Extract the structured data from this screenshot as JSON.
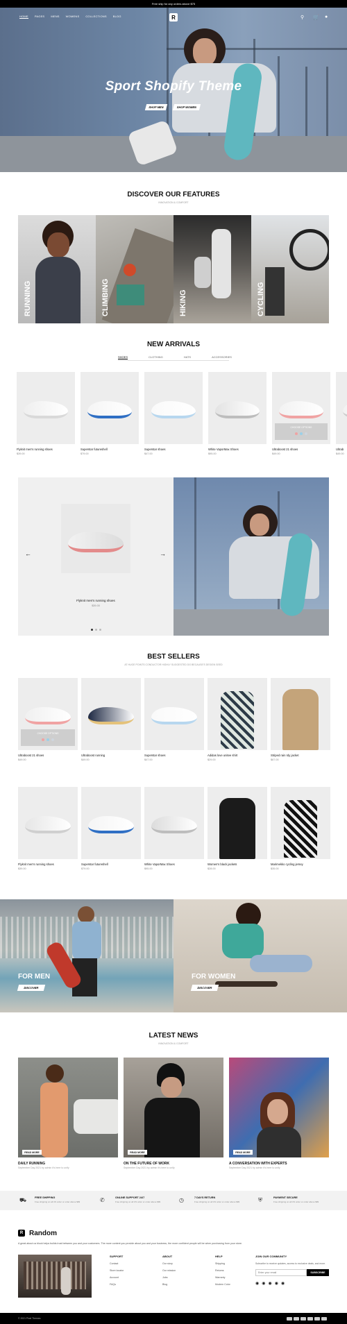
{
  "announcement": "Free ship for any orders above $75",
  "nav": {
    "items": [
      "HOME",
      "PAGES",
      "MENS",
      "WOMENS",
      "COLLECTIONS",
      "BLOG"
    ],
    "logo": "R"
  },
  "hero": {
    "title": "Sport Shopify Theme",
    "btn_men": "SHOP MEN",
    "btn_women": "SHOP WOMEN"
  },
  "features": {
    "title": "DISCOVER OUR FEATURES",
    "subtitle": "INNOVATION & COMFORT",
    "items": [
      "RUNNING",
      "CLIMBING",
      "HIKING",
      "CYCLING"
    ]
  },
  "arrivals": {
    "title": "NEW ARRIVALS",
    "tabs": [
      "SHOES",
      "CLOTHING",
      "HATS",
      "ACCESSORIES"
    ],
    "products": [
      {
        "name": "Flyknit men's running shoes",
        "price": "$39.00"
      },
      {
        "name": "Superstar futureshell",
        "price": "$79.00"
      },
      {
        "name": "Superstar shoes",
        "price": "$47.00"
      },
      {
        "name": "White VaporMax Shoes",
        "price": "$95.00"
      },
      {
        "name": "Ultraboost 21 shoes",
        "price": "$49.00"
      },
      {
        "name": "Ultrab",
        "price": "$49.00"
      }
    ],
    "hover_label": "CHOOSE OPTIONS"
  },
  "promo": {
    "name": "Flyknit men's running shoes",
    "price": "$39.00"
  },
  "bestsellers": {
    "title": "BEST SELLERS",
    "subtitle": "AT HUGE POINTS CONDUCTOR HIGHLY SUGGESTED DO BECAUSE'S DESIGN SEED",
    "row1": [
      {
        "name": "Ultraboost 21 shoes",
        "price": "$49.00"
      },
      {
        "name": "Ultraboost running",
        "price": "$49.00"
      },
      {
        "name": "Superstar shoes",
        "price": "$47.00"
      },
      {
        "name": "Adidas love unitee shirt",
        "price": "$29.00"
      },
      {
        "name": "Striped rain rdy jacket",
        "price": "$67.00"
      }
    ],
    "row2": [
      {
        "name": "Flyknit men's running shoes",
        "price": "$39.00"
      },
      {
        "name": "Superstar futureshell",
        "price": "$79.00"
      },
      {
        "name": "White VaporMax Shoes",
        "price": "$95.00"
      },
      {
        "name": "Women's black jackets",
        "price": "$28.00"
      },
      {
        "name": "Marimekko cycling jersey",
        "price": "$35.00"
      }
    ],
    "hover_label": "CHOOSE OPTIONS"
  },
  "banners": [
    {
      "title": "FOR MEN",
      "button": "DISCOVER"
    },
    {
      "title": "FOR WOMEN",
      "button": "DISCOVER"
    }
  ],
  "news": {
    "title": "LATEST NEWS",
    "subtitle": "INNOVATION & COMFORT",
    "items": [
      {
        "title": "DAILY RUNNING",
        "date": "September Day 2021 by admin it's here to unify",
        "button": "READ MORE"
      },
      {
        "title": "ON THE FUTURE OF WORK",
        "date": "September Day 2021 by admin it's here to unify",
        "button": "READ MORE"
      },
      {
        "title": "A CONVERSATION WITH EXPERTS",
        "date": "September Day 2021 by admin it's here to unify",
        "button": "READ MORE"
      }
    ]
  },
  "service": [
    {
      "title": "FREE SHIPPING",
      "desc": "Free shipping on all US order or order above $99",
      "icon": "truck-icon"
    },
    {
      "title": "ONLINE SUPPORT 24/7",
      "desc": "Free shipping on all US order or order above $99",
      "icon": "phone-icon"
    },
    {
      "title": "7 DAYS RETURN",
      "desc": "Free shipping on all US order or order above $99",
      "icon": "clock-icon"
    },
    {
      "title": "PAYMENT SECURE",
      "desc": "Free shipping on all US order or order above $99",
      "icon": "shield-icon"
    }
  ],
  "footer": {
    "brand": "Random",
    "about": "A great about us block helps builds trust between you and your customers. The more content you provide about you and your business, the more confident people will be when purchasing from your store.",
    "columns": [
      {
        "title": "SUPPORT",
        "links": [
          "Contact",
          "Store locator",
          "Account",
          "FAQs"
        ]
      },
      {
        "title": "ABOUT",
        "links": [
          "Our story",
          "Our mission",
          "Jobs",
          "Blog"
        ]
      },
      {
        "title": "HELP",
        "links": [
          "Shipping",
          "Returns",
          "Warranty",
          "Modern Color"
        ]
      }
    ],
    "newsletter": {
      "title": "JOIN OUR COMMUNITY",
      "text": "Subscribe to receive updates, access to exclusive deals, and more.",
      "placeholder": "Enter your email",
      "button": "SUBSCRIBE"
    },
    "copyright": "© 2021 Pixel Themes"
  },
  "colors": {
    "accent": "#000000",
    "card_bg": "#ededed",
    "service_bg": "#f2f2f2"
  }
}
